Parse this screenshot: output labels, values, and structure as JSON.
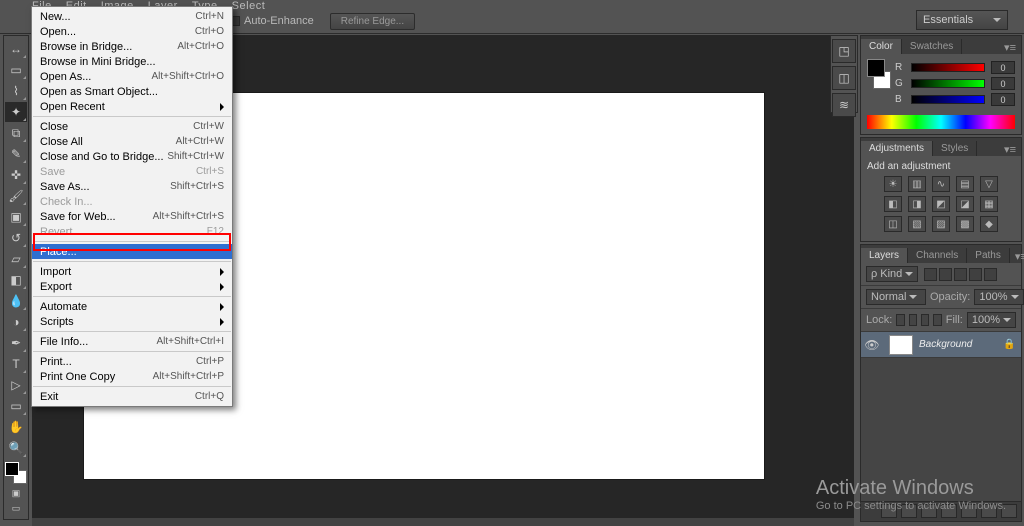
{
  "top_menu": [
    "File",
    "Edit",
    "Image",
    "Layer",
    "Type",
    "Select"
  ],
  "optionbar": {
    "auto_enhance": "Auto-Enhance",
    "refine_edge": "Refine Edge..."
  },
  "workspace_selector": "Essentials",
  "file_menu": {
    "group1": [
      {
        "label": "New...",
        "shortcut": "Ctrl+N"
      },
      {
        "label": "Open...",
        "shortcut": "Ctrl+O"
      },
      {
        "label": "Browse in Bridge...",
        "shortcut": "Alt+Ctrl+O"
      },
      {
        "label": "Browse in Mini Bridge..."
      },
      {
        "label": "Open As...",
        "shortcut": "Alt+Shift+Ctrl+O"
      },
      {
        "label": "Open as Smart Object..."
      },
      {
        "label": "Open Recent",
        "submenu": true
      }
    ],
    "group2": [
      {
        "label": "Close",
        "shortcut": "Ctrl+W"
      },
      {
        "label": "Close All",
        "shortcut": "Alt+Ctrl+W"
      },
      {
        "label": "Close and Go to Bridge...",
        "shortcut": "Shift+Ctrl+W"
      },
      {
        "label": "Save",
        "shortcut": "Ctrl+S",
        "disabled": true
      },
      {
        "label": "Save As...",
        "shortcut": "Shift+Ctrl+S"
      },
      {
        "label": "Check In...",
        "disabled": true
      },
      {
        "label": "Save for Web...",
        "shortcut": "Alt+Shift+Ctrl+S"
      },
      {
        "label": "Revert",
        "shortcut": "F12",
        "disabled": true
      }
    ],
    "group3": [
      {
        "label": "Place...",
        "hover": true
      }
    ],
    "group4": [
      {
        "label": "Import",
        "submenu": true
      },
      {
        "label": "Export",
        "submenu": true
      }
    ],
    "group5": [
      {
        "label": "Automate",
        "submenu": true
      },
      {
        "label": "Scripts",
        "submenu": true
      }
    ],
    "group6": [
      {
        "label": "File Info...",
        "shortcut": "Alt+Shift+Ctrl+I"
      }
    ],
    "group7": [
      {
        "label": "Print...",
        "shortcut": "Ctrl+P"
      },
      {
        "label": "Print One Copy",
        "shortcut": "Alt+Shift+Ctrl+P"
      }
    ],
    "group8": [
      {
        "label": "Exit",
        "shortcut": "Ctrl+Q"
      }
    ]
  },
  "panels": {
    "color": {
      "tabs": [
        "Color",
        "Swatches"
      ],
      "r": "0",
      "g": "0",
      "b": "0",
      "channels": [
        "R",
        "G",
        "B"
      ]
    },
    "adjustments": {
      "tabs": [
        "Adjustments",
        "Styles"
      ],
      "heading": "Add an adjustment"
    },
    "layers": {
      "tabs": [
        "Layers",
        "Channels",
        "Paths"
      ],
      "kind": "Kind",
      "blend": "Normal",
      "opacity_label": "Opacity:",
      "opacity": "100%",
      "lock_label": "Lock:",
      "fill_label": "Fill:",
      "fill": "100%",
      "layer_name": "Background"
    }
  },
  "tool_icons": [
    "▤",
    "⬚",
    "◌",
    "✦",
    "✎",
    "✃",
    "▱",
    "✜",
    "◧",
    "●",
    "◑",
    "T",
    "▷",
    "✥",
    "⬚",
    "✋",
    "🔍"
  ],
  "watermark": {
    "title": "Activate Windows",
    "sub": "Go to PC settings to activate Windows."
  }
}
